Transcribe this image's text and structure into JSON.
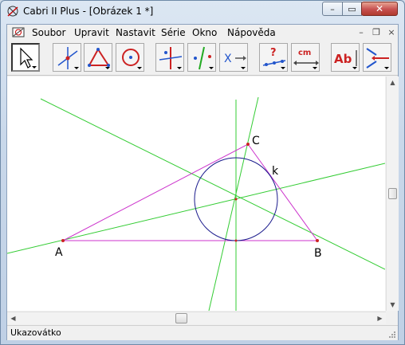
{
  "window": {
    "title": "Cabri II Plus - [Obrázek 1 *]"
  },
  "window_controls": {
    "minimize": "–",
    "maximize": "▭",
    "close": "✕"
  },
  "menu": {
    "items": [
      "Soubor",
      "Upravit",
      "Nastavit",
      "Série",
      "Okno",
      "Nápověda"
    ],
    "mdi_minimize": "–",
    "mdi_restore": "❐",
    "mdi_close": "×"
  },
  "toolbar": {
    "tools": [
      "pointer",
      "point",
      "triangle",
      "circle",
      "perpendicular",
      "symmetry",
      "transform",
      "check-property",
      "measure",
      "text-label",
      "display-attributes"
    ],
    "measure_label": "cm",
    "text_label": "Ab",
    "check_label": "?",
    "transform_label": "X"
  },
  "figure": {
    "labels": {
      "A": "A",
      "B": "B",
      "C": "C",
      "k": "k"
    },
    "colors": {
      "triangle": "#cc33cc",
      "lines": "#33cc33",
      "circle": "#1a1a8c",
      "points": "#cc2222"
    }
  },
  "status": {
    "text": "Ukazovátko"
  }
}
